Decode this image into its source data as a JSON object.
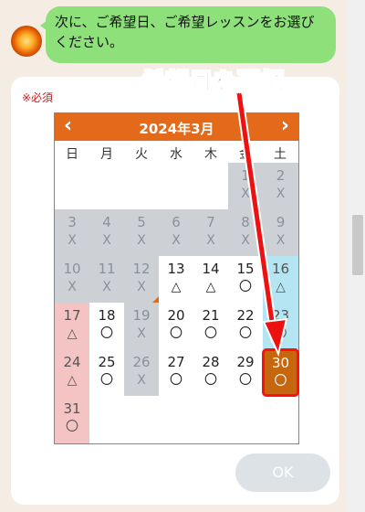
{
  "chat": {
    "message": "次に、ご希望日、ご希望レッスンをお選びください。"
  },
  "form": {
    "required_label": "※必須",
    "ok_label": "OK"
  },
  "annotation": {
    "text": "希望日を選択"
  },
  "calendar": {
    "title": "2024年3月",
    "prev_label": "‹",
    "next_label": "›",
    "weekdays": [
      "日",
      "月",
      "火",
      "水",
      "木",
      "金",
      "土"
    ],
    "days": [
      {
        "day": "1",
        "mark": "X"
      },
      {
        "day": "2",
        "mark": "X"
      },
      {
        "day": "3",
        "mark": "X"
      },
      {
        "day": "4",
        "mark": "X"
      },
      {
        "day": "5",
        "mark": "X"
      },
      {
        "day": "6",
        "mark": "X"
      },
      {
        "day": "7",
        "mark": "X"
      },
      {
        "day": "8",
        "mark": "X"
      },
      {
        "day": "9",
        "mark": "X"
      },
      {
        "day": "10",
        "mark": "X"
      },
      {
        "day": "11",
        "mark": "X"
      },
      {
        "day": "12",
        "mark": "X"
      },
      {
        "day": "13",
        "mark": "△"
      },
      {
        "day": "14",
        "mark": "△"
      },
      {
        "day": "15",
        "mark": "〇"
      },
      {
        "day": "16",
        "mark": "△"
      },
      {
        "day": "17",
        "mark": "△"
      },
      {
        "day": "18",
        "mark": "〇"
      },
      {
        "day": "19",
        "mark": "X"
      },
      {
        "day": "20",
        "mark": "〇"
      },
      {
        "day": "21",
        "mark": "〇"
      },
      {
        "day": "22",
        "mark": "〇"
      },
      {
        "day": "23",
        "mark": "〇"
      },
      {
        "day": "24",
        "mark": "△"
      },
      {
        "day": "25",
        "mark": "〇"
      },
      {
        "day": "26",
        "mark": "X"
      },
      {
        "day": "27",
        "mark": "〇"
      },
      {
        "day": "28",
        "mark": "〇"
      },
      {
        "day": "29",
        "mark": "〇"
      },
      {
        "day": "30",
        "mark": "〇"
      },
      {
        "day": "31",
        "mark": "〇"
      }
    ],
    "selected_day": "30",
    "colors": {
      "accent": "#e26a1a",
      "past": "#cdd1d6",
      "sunday": "#f4c3c3",
      "saturday": "#b5e4f2",
      "selected": "#c6670f",
      "highlight": "#ff1010"
    }
  }
}
